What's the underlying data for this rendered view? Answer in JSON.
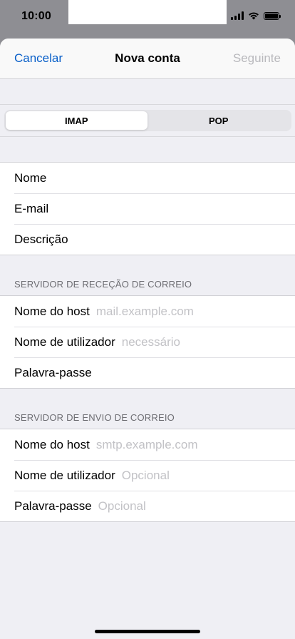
{
  "status_bar": {
    "time": "10:00",
    "icons": [
      "signal-icon",
      "wifi-icon",
      "battery-icon"
    ]
  },
  "navbar": {
    "cancel_label": "Cancelar",
    "title": "Nova conta",
    "next_label": "Seguinte"
  },
  "segment": {
    "options": [
      "IMAP",
      "POP"
    ],
    "selected": "IMAP"
  },
  "account": {
    "name_label": "Nome",
    "email_label": "E-mail",
    "description_label": "Descrição"
  },
  "incoming": {
    "header": "SERVIDOR DE RECEÇÃO DE CORREIO",
    "host_label": "Nome do host",
    "host_placeholder": "mail.example.com",
    "user_label": "Nome de utilizador",
    "user_placeholder": "necessário",
    "password_label": "Palavra-passe"
  },
  "outgoing": {
    "header": "SERVIDOR DE ENVIO DE CORREIO",
    "host_label": "Nome do host",
    "host_placeholder": "smtp.example.com",
    "user_label": "Nome de utilizador",
    "user_placeholder": "Opcional",
    "password_label": "Palavra-passe",
    "password_placeholder": "Opcional"
  },
  "colors": {
    "accent": "#0a60c9",
    "disabled": "#b9b9bd",
    "placeholder": "#c2c2c6",
    "background": "#efeff4"
  }
}
